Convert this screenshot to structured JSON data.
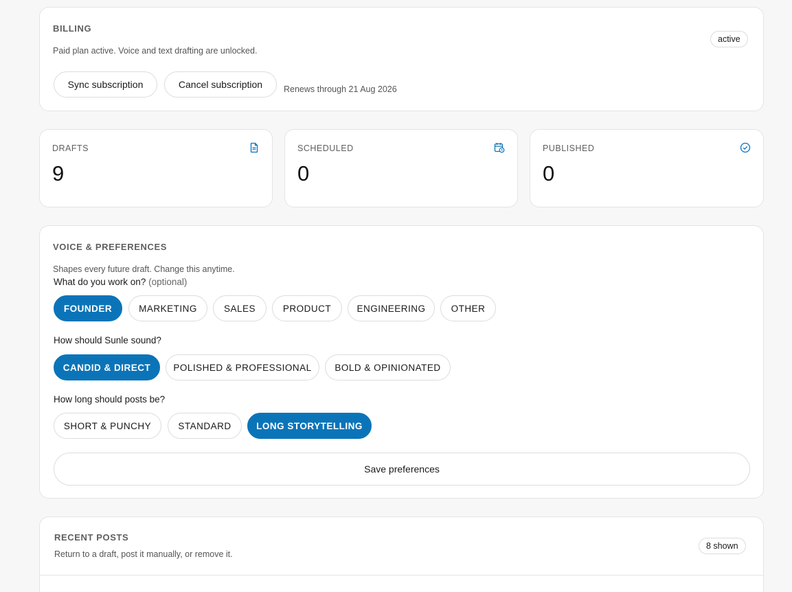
{
  "billing": {
    "title": "BILLING",
    "description": "Paid plan active. Voice and text drafting are unlocked.",
    "status_badge": "active",
    "sync_button": "Sync subscription",
    "cancel_button": "Cancel subscription",
    "renewal_text": "Renews through 21 Aug 2026"
  },
  "stats": [
    {
      "label": "DRAFTS",
      "value": "9",
      "icon": "document-icon"
    },
    {
      "label": "SCHEDULED",
      "value": "0",
      "icon": "calendar-clock-icon"
    },
    {
      "label": "PUBLISHED",
      "value": "0",
      "icon": "check-circle-icon"
    }
  ],
  "preferences": {
    "title": "VOICE & PREFERENCES",
    "description": "Shapes every future draft. Change this anytime.",
    "work_question": "What do you work on?",
    "work_optional": "(optional)",
    "work_options": [
      "FOUNDER",
      "MARKETING",
      "SALES",
      "PRODUCT",
      "ENGINEERING",
      "OTHER"
    ],
    "work_selected": "FOUNDER",
    "sound_question": "How should Sunle sound?",
    "sound_options": [
      "CANDID & DIRECT",
      "POLISHED & PROFESSIONAL",
      "BOLD & OPINIONATED"
    ],
    "sound_selected": "CANDID & DIRECT",
    "length_question": "How long should posts be?",
    "length_options": [
      "SHORT & PUNCHY",
      "STANDARD",
      "LONG STORYTELLING"
    ],
    "length_selected": "LONG STORYTELLING",
    "save_button": "Save preferences"
  },
  "recent_posts": {
    "title": "RECENT POSTS",
    "description": "Return to a draft, post it manually, or remove it.",
    "count_badge": "8 shown"
  },
  "colors": {
    "accent": "#0b74b8",
    "border": "#e4e4e4",
    "background": "#f7f7f7"
  }
}
